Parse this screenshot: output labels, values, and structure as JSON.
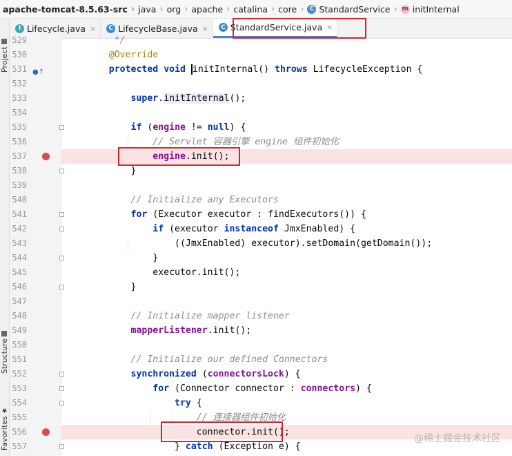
{
  "breadcrumb": [
    {
      "label": "apache-tomcat-8.5.63-src",
      "icon": null
    },
    {
      "label": "java",
      "icon": null
    },
    {
      "label": "org",
      "icon": null
    },
    {
      "label": "apache",
      "icon": null
    },
    {
      "label": "catalina",
      "icon": null
    },
    {
      "label": "core",
      "icon": null
    },
    {
      "label": "StandardService",
      "icon": "class-icon",
      "icon_char": "C"
    },
    {
      "label": "initInternal",
      "icon": "method-icon",
      "icon_char": "m"
    }
  ],
  "tabs": [
    {
      "label": "Lifecycle.java",
      "icon": "interface-icon",
      "icon_char": "I",
      "active": false,
      "close": "×"
    },
    {
      "label": "LifecycleBase.java",
      "icon": "class-icon",
      "icon_char": "C",
      "active": false,
      "close": "×"
    },
    {
      "label": "StandardService.java",
      "icon": "class-icon",
      "icon_char": "C",
      "active": true,
      "close": "×"
    }
  ],
  "side_labels": {
    "project": "Project",
    "structure": "Structure",
    "favorites": "Favorites"
  },
  "watermark": "@稀土掘金技术社区",
  "colors": {
    "breakpoint": "#db4a4f",
    "breakpoint_line": "#fbe3e4",
    "highlight_box": "#d9222a",
    "keyword": "#0033b3",
    "annotation": "#9e880d",
    "comment": "#8c8c8c",
    "field": "#871094"
  },
  "code": [
    {
      "num": "529",
      "segs": [
        {
          "t": "     */",
          "c": "cm"
        }
      ]
    },
    {
      "num": "530",
      "segs": [
        {
          "t": "    "
        },
        {
          "t": "@Override",
          "c": "ann"
        }
      ]
    },
    {
      "num": "531",
      "impl": true,
      "segs": [
        {
          "t": "    "
        },
        {
          "t": "protected",
          "c": "kw"
        },
        {
          "t": " "
        },
        {
          "t": "void",
          "c": "kw"
        },
        {
          "t": " "
        },
        {
          "t": "initInternal",
          "c": "caret"
        },
        {
          "t": "() "
        },
        {
          "t": "throws",
          "c": "kw"
        },
        {
          "t": " LifecycleException {"
        }
      ]
    },
    {
      "num": "532",
      "segs": []
    },
    {
      "num": "533",
      "segs": [
        {
          "t": "        "
        },
        {
          "t": "super",
          "c": "kw"
        },
        {
          "t": "."
        },
        {
          "t": "initInternal",
          "c": "call"
        },
        {
          "t": "();"
        }
      ]
    },
    {
      "num": "534",
      "segs": []
    },
    {
      "num": "535",
      "fold": true,
      "segs": [
        {
          "t": "        "
        },
        {
          "t": "if",
          "c": "kw"
        },
        {
          "t": " ("
        },
        {
          "t": "engine",
          "c": "fd"
        },
        {
          "t": " != "
        },
        {
          "t": "null",
          "c": "kw"
        },
        {
          "t": ") {"
        }
      ]
    },
    {
      "num": "536",
      "segs": [
        {
          "t": "            "
        },
        {
          "t": "// Servlet 容器引擎 engine 组件初始化",
          "c": "cm"
        }
      ]
    },
    {
      "num": "537",
      "bp": true,
      "segs": [
        {
          "t": "            "
        },
        {
          "t": "engine",
          "c": "fd"
        },
        {
          "t": ".init();"
        }
      ]
    },
    {
      "num": "538",
      "fold": true,
      "segs": [
        {
          "t": "        }"
        }
      ]
    },
    {
      "num": "539",
      "segs": []
    },
    {
      "num": "540",
      "segs": [
        {
          "t": "        "
        },
        {
          "t": "// Initialize any Executors",
          "c": "cm"
        }
      ]
    },
    {
      "num": "541",
      "fold": true,
      "segs": [
        {
          "t": "        "
        },
        {
          "t": "for",
          "c": "kw"
        },
        {
          "t": " (Executor executor : findExecutors()) {"
        }
      ]
    },
    {
      "num": "542",
      "fold": true,
      "segs": [
        {
          "t": "            "
        },
        {
          "t": "if",
          "c": "kw"
        },
        {
          "t": " (executor "
        },
        {
          "t": "instanceof",
          "c": "kw"
        },
        {
          "t": " JmxEnabled) {"
        }
      ]
    },
    {
      "num": "543",
      "segs": [
        {
          "t": "                ((JmxEnabled) executor).setDomain(getDomain());"
        }
      ]
    },
    {
      "num": "544",
      "fold": true,
      "segs": [
        {
          "t": "            }"
        }
      ]
    },
    {
      "num": "545",
      "segs": [
        {
          "t": "            executor.init();"
        }
      ]
    },
    {
      "num": "546",
      "fold": true,
      "segs": [
        {
          "t": "        }"
        }
      ]
    },
    {
      "num": "547",
      "segs": []
    },
    {
      "num": "548",
      "segs": [
        {
          "t": "        "
        },
        {
          "t": "// Initialize mapper listener",
          "c": "cm"
        }
      ]
    },
    {
      "num": "549",
      "segs": [
        {
          "t": "        "
        },
        {
          "t": "mapperListener",
          "c": "fd"
        },
        {
          "t": ".init();"
        }
      ]
    },
    {
      "num": "550",
      "segs": []
    },
    {
      "num": "551",
      "segs": [
        {
          "t": "        "
        },
        {
          "t": "// Initialize our defined Connectors",
          "c": "cm"
        }
      ]
    },
    {
      "num": "552",
      "fold": true,
      "segs": [
        {
          "t": "        "
        },
        {
          "t": "synchronized",
          "c": "kw"
        },
        {
          "t": " ("
        },
        {
          "t": "connectorsLock",
          "c": "fd"
        },
        {
          "t": ") {"
        }
      ]
    },
    {
      "num": "553",
      "fold": true,
      "segs": [
        {
          "t": "            "
        },
        {
          "t": "for",
          "c": "kw"
        },
        {
          "t": " (Connector connector : "
        },
        {
          "t": "connectors",
          "c": "fd"
        },
        {
          "t": ") {"
        }
      ]
    },
    {
      "num": "554",
      "fold": true,
      "segs": [
        {
          "t": "                "
        },
        {
          "t": "try",
          "c": "kw"
        },
        {
          "t": " {"
        }
      ]
    },
    {
      "num": "555",
      "segs": [
        {
          "t": "                    "
        },
        {
          "t": "// 连接器组件初始化",
          "c": "cm"
        }
      ]
    },
    {
      "num": "556",
      "bp": true,
      "segs": [
        {
          "t": "                    connector.init();"
        }
      ]
    },
    {
      "num": "557",
      "fold": true,
      "segs": [
        {
          "t": "                } "
        },
        {
          "t": "catch",
          "c": "kw"
        },
        {
          "t": " (Exception e) {"
        }
      ]
    }
  ]
}
